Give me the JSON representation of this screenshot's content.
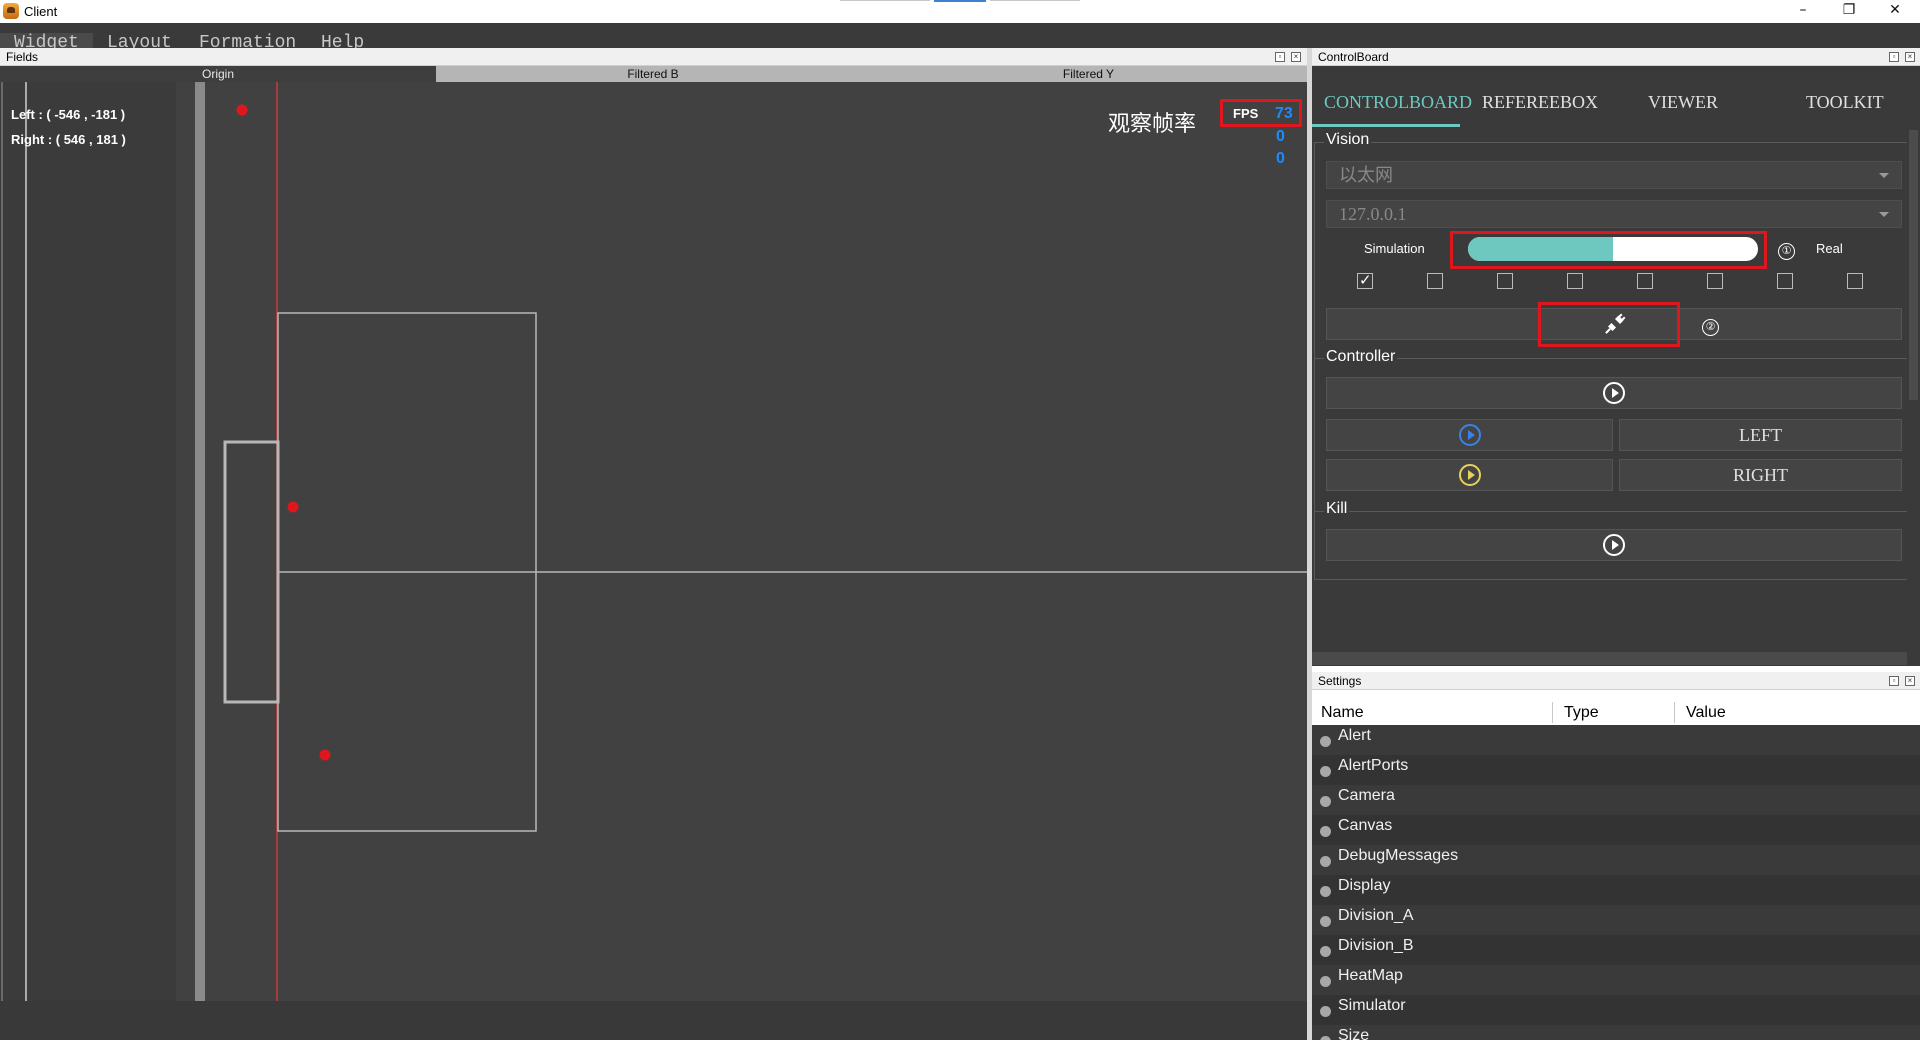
{
  "window": {
    "title": "Client",
    "minimize": "–",
    "maximize": "❐",
    "close": "✕"
  },
  "menu": {
    "items": [
      "Widget",
      "Layout",
      "Formation",
      "Help"
    ]
  },
  "fields_panel": {
    "title": "Fields",
    "tabs": [
      "Origin",
      "Filtered B",
      "Filtered Y"
    ],
    "active_tab": "Origin",
    "left_coord": "Left : ( -546 , -181 )",
    "right_coord": "Right : ( 546 , 181 )",
    "fps_label": "FPS",
    "fps_value": "73",
    "fps_aux_1": "0",
    "fps_aux_2": "0",
    "fps_annotation": "观察帧率"
  },
  "control_board": {
    "title": "ControlBoard",
    "tabs": [
      "CONTROLBOARD",
      "REFEREEBOX",
      "VIEWER",
      "TOOLKIT"
    ],
    "active_tab": "CONTROLBOARD",
    "vision": {
      "title": "Vision",
      "interface_value": "以太网",
      "ip_value": "127.0.0.1",
      "mode_left": "Simulation",
      "mode_right": "Real",
      "toggle_level": 0.5,
      "annotation_1": "①",
      "annotation_2": "②",
      "checkboxes": [
        true,
        false,
        false,
        false,
        false,
        false,
        false,
        false
      ]
    },
    "controller": {
      "title": "Controller",
      "left_label": "LEFT",
      "right_label": "RIGHT"
    },
    "kill": {
      "title": "Kill"
    }
  },
  "settings": {
    "title": "Settings",
    "columns": [
      "Name",
      "Type",
      "Value"
    ],
    "rows": [
      "Alert",
      "AlertPorts",
      "Camera",
      "Canvas",
      "DebugMessages",
      "Display",
      "Division_A",
      "Division_B",
      "HeatMap",
      "Simulator",
      "Size"
    ]
  },
  "colors": {
    "accent": "#6ec8c0",
    "highlight_red": "#e0161e",
    "fps_blue": "#1a8cff",
    "field_bg": "#414141",
    "ball_red": "#e0161e"
  }
}
